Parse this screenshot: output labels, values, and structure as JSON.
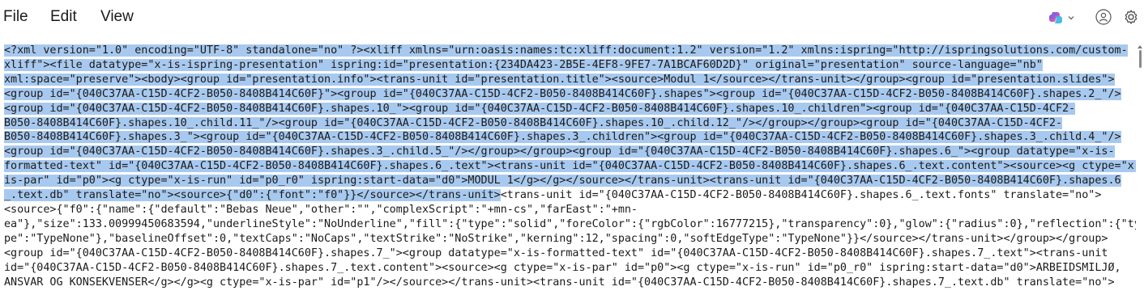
{
  "menu": {
    "file": "File",
    "edit": "Edit",
    "view": "View"
  },
  "toolbar": {
    "copilot_icon": "copilot-icon",
    "account_icon": "account-icon",
    "settings_icon": "gear-icon"
  },
  "editor": {
    "selected_lines": [
      "<?xml version=\"1.0\" encoding=\"UTF-8\" standalone=\"no\" ?><xliff xmlns=\"urn:oasis:names:tc:xliff:document:1.2\" version=\"1.2\" xmlns:ispring=\"http://ispringsolutions.com/custom-",
      "xliff\"><file datatype=\"x-is-ispring-presentation\" ispring:id=\"presentation:{234DA423-2B5E-4EF8-9FE7-7A1BCAF60D2D}\" original=\"presentation\" source-language=\"nb\"",
      "xml:space=\"preserve\"><body><group id=\"presentation.info\"><trans-unit id=\"presentation.title\"><source>Modul 1</source></trans-unit></group><group id=\"presentation.slides\">",
      "<group id=\"{040C37AA-C15D-4CF2-B050-8408B414C60F}\"><group id=\"{040C37AA-C15D-4CF2-B050-8408B414C60F}.shapes\"><group id=\"{040C37AA-C15D-4CF2-B050-8408B414C60F}.shapes.2_\"/>",
      "<group id=\"{040C37AA-C15D-4CF2-B050-8408B414C60F}.shapes.10_\"><group id=\"{040C37AA-C15D-4CF2-B050-8408B414C60F}.shapes.10_.children\"><group id=\"{040C37AA-C15D-4CF2-",
      "B050-8408B414C60F}.shapes.10_.child.11_\"/><group id=\"{040C37AA-C15D-4CF2-B050-8408B414C60F}.shapes.10_.child.12_\"/></group></group><group id=\"{040C37AA-C15D-4CF2-",
      "B050-8408B414C60F}.shapes.3_\"><group id=\"{040C37AA-C15D-4CF2-B050-8408B414C60F}.shapes.3_.children\"><group id=\"{040C37AA-C15D-4CF2-B050-8408B414C60F}.shapes.3_.child.4_\"/>",
      "<group id=\"{040C37AA-C15D-4CF2-B050-8408B414C60F}.shapes.3_.child.5_\"/></group></group><group id=\"{040C37AA-C15D-4CF2-B050-8408B414C60F}.shapes.6_\"><group datatype=\"x-is-",
      "formatted-text\" id=\"{040C37AA-C15D-4CF2-B050-8408B414C60F}.shapes.6_.text\"><trans-unit id=\"{040C37AA-C15D-4CF2-B050-8408B414C60F}.shapes.6_.text.content\"><source><g ctype=\"x-",
      "is-par\" id=\"p0\"><g ctype=\"x-is-run\" id=\"p0_r0\" ispring:start-data=\"d0\">MODUL 1</g></g></source></trans-unit><trans-unit id=\"{040C37AA-C15D-4CF2-B050-8408B414C60F}.shapes.6",
      "_.text.db\" translate=\"no\"><source>{\"d0\":{\"font\":\"f0\"}}</source></trans-unit>"
    ],
    "line10_tail": "<trans-unit id=\"{040C37AA-C15D-4CF2-B050-8408B414C60F}.shapes.6_.text.fonts\" translate=\"no\">",
    "plain_lines": [
      "<source>{\"f0\":{\"name\":{\"default\":\"Bebas Neue\",\"other\":\"\",\"complexScript\":\"+mn-cs\",\"farEast\":\"+mn-",
      "ea\"},\"size\":133.00999450683594,\"underlineStyle\":\"NoUnderline\",\"fill\":{\"type\":\"solid\",\"foreColor\":{\"rgbColor\":16777215},\"transparency\":0},\"glow\":{\"radius\":0},\"reflection\":{\"ty",
      "pe\":\"TypeNone\"},\"baselineOffset\":0,\"textCaps\":\"NoCaps\",\"textStrike\":\"NoStrike\",\"kerning\":12,\"spacing\":0,\"softEdgeType\":\"TypeNone\"}}</source></trans-unit></group></group>",
      "<group id=\"{040C37AA-C15D-4CF2-B050-8408B414C60F}.shapes.7_\"><group datatype=\"x-is-formatted-text\" id=\"{040C37AA-C15D-4CF2-B050-8408B414C60F}.shapes.7_.text\"><trans-unit",
      "id=\"{040C37AA-C15D-4CF2-B050-8408B414C60F}.shapes.7_.text.content\"><source><g ctype=\"x-is-par\" id=\"p0\"><g ctype=\"x-is-run\" id=\"p0_r0\" ispring:start-data=\"d0\">ARBEIDSMILJØ,",
      "ANSVAR OG KONSEKVENSER</g></g><g ctype=\"x-is-par\" id=\"p1\"/></source></trans-unit><trans-unit id=\"{040C37AA-C15D-4CF2-B050-8408B414C60F}.shapes.7_.text.db\" translate=\"no\">"
    ]
  },
  "colors": {
    "selection": "#a8c9ef",
    "text": "#1a1a1a",
    "background": "#ffffff"
  }
}
